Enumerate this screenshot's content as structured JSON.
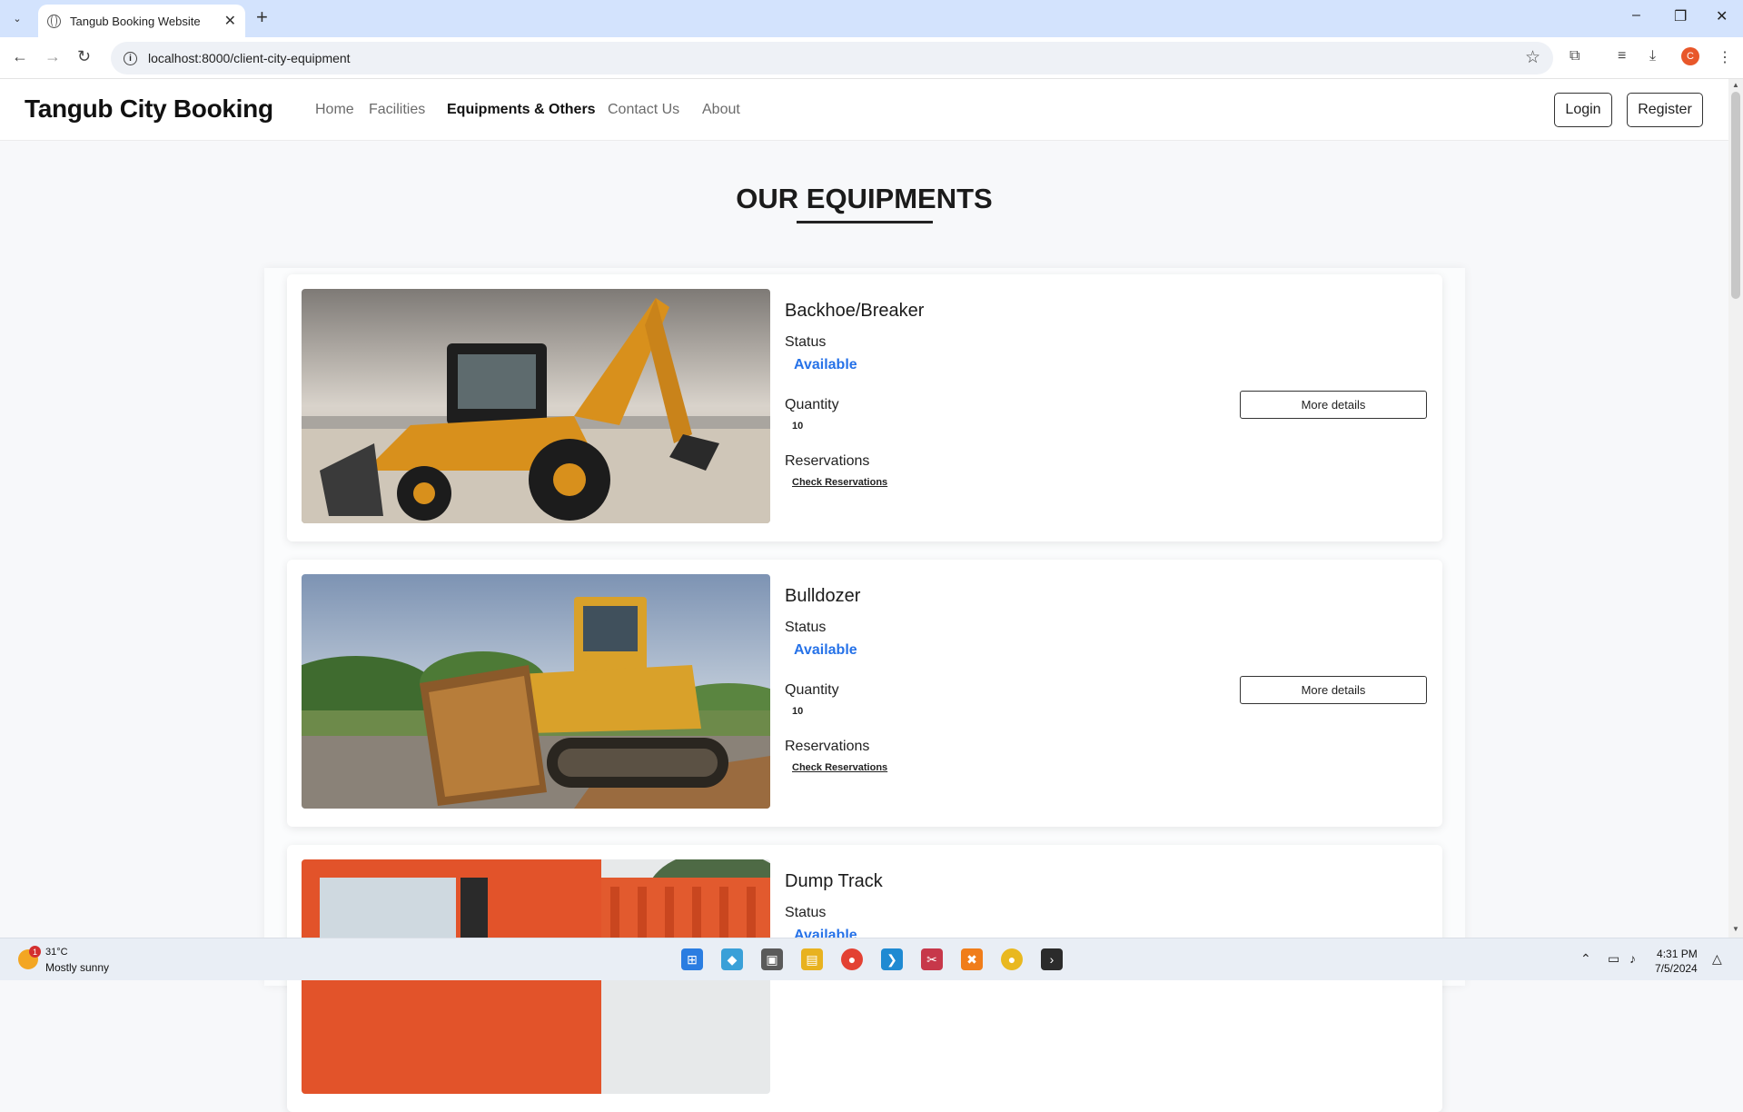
{
  "browser": {
    "tab_title": "Tangub Booking Website",
    "url": "localhost:8000/client-city-equipment",
    "profile_initial": "C"
  },
  "site": {
    "brand": "Tangub City Booking",
    "nav": [
      {
        "label": "Home",
        "active": false
      },
      {
        "label": "Facilities",
        "active": false
      },
      {
        "label": "Equipments & Others",
        "active": true
      },
      {
        "label": "Contact Us",
        "active": false
      },
      {
        "label": "About",
        "active": false
      }
    ],
    "login_label": "Login",
    "register_label": "Register"
  },
  "page": {
    "title": "OUR EQUIPMENTS"
  },
  "labels": {
    "status": "Status",
    "quantity": "Quantity",
    "reservations": "Reservations",
    "check_reservations": "Check Reservations",
    "more_details": "More details"
  },
  "equipments": [
    {
      "name": "Backhoe/Breaker",
      "status": "Available",
      "quantity": "10"
    },
    {
      "name": "Bulldozer",
      "status": "Available",
      "quantity": "10"
    },
    {
      "name": "Dump Track",
      "status": "Available",
      "quantity": ""
    }
  ],
  "colors": {
    "status_available": "#2672e8",
    "accent": "#111111"
  },
  "taskbar": {
    "weather_temp": "31°C",
    "weather_desc": "Mostly sunny",
    "weather_badge": "1",
    "time": "4:31 PM",
    "date": "7/5/2024"
  }
}
